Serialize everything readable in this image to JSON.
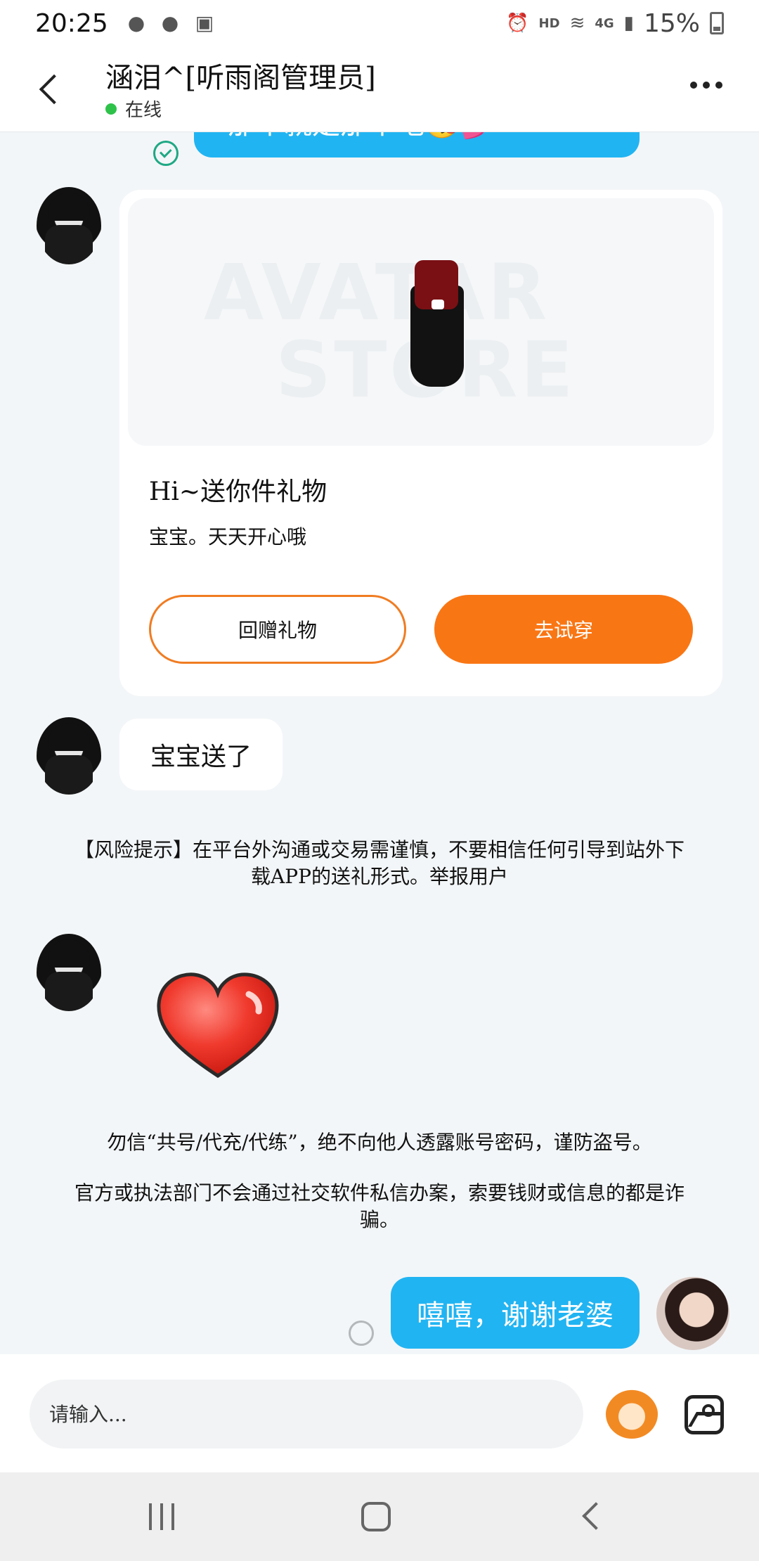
{
  "status_bar": {
    "time": "20:25",
    "network": "HD",
    "network2": "4G",
    "battery": "15%"
  },
  "header": {
    "contact_name": "涵泪^[听雨阁管理员]",
    "status": "在线"
  },
  "messages": {
    "top_partial": "那个就是那个吧😘💕",
    "gift_card": {
      "watermark_1": "AVATAR",
      "watermark_2": "STORE",
      "title": "Hi~送你件礼物",
      "message": "宝宝。天天开心哦",
      "return_button": "回赠礼物",
      "try_button": "去试穿"
    },
    "them_text": "宝宝送了",
    "risk_notice": "【风险提示】在平台外沟通或交易需谨慎，不要相信任何引导到站外下载APP的送礼形式。举报用户",
    "warning_1": "勿信“共号/代充/代练”，绝不向他人透露账号密码，谨防盗号。",
    "warning_2": "官方或执法部门不会通过社交软件私信办案，索要钱财或信息的都是诈骗。",
    "me_text": "嘻嘻，谢谢老婆"
  },
  "input": {
    "placeholder": "请输入..."
  },
  "icons": {
    "back": "back-arrow-icon",
    "more": "more-dots-icon",
    "check": "check-circle-icon",
    "emoji": "emoji-sticker-icon",
    "image": "image-icon",
    "heart": "heart-sticker"
  },
  "colors": {
    "accent_blue": "#21b4f2",
    "accent_orange": "#f97614",
    "online_green": "#2ec24a"
  }
}
